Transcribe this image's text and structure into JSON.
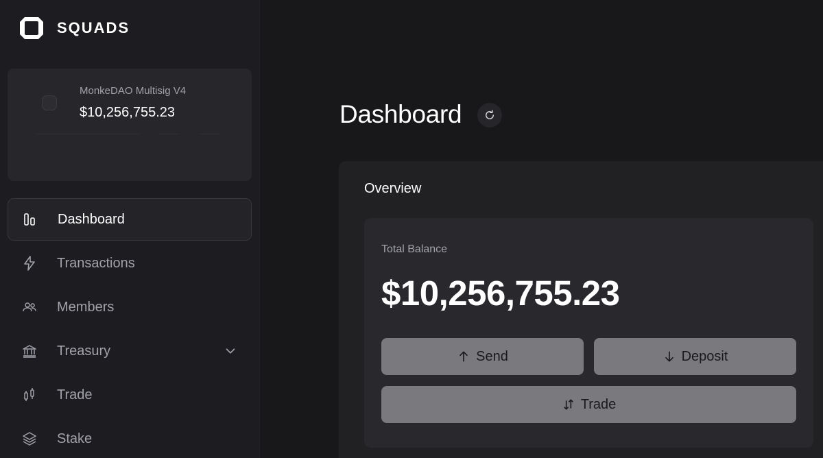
{
  "brand": {
    "name": "SQUADS"
  },
  "wallet": {
    "name": "MonkeDAO Multisig V4",
    "balance": "$10,256,755.23"
  },
  "nav": {
    "items": [
      {
        "label": "Dashboard",
        "icon": "bar-columns-icon",
        "active": true
      },
      {
        "label": "Transactions",
        "icon": "lightning-icon",
        "active": false
      },
      {
        "label": "Members",
        "icon": "users-icon",
        "active": false
      },
      {
        "label": "Treasury",
        "icon": "bank-icon",
        "active": false,
        "expandable": true
      },
      {
        "label": "Trade",
        "icon": "candlestick-icon",
        "active": false
      },
      {
        "label": "Stake",
        "icon": "layers-icon",
        "active": false
      }
    ]
  },
  "main": {
    "title": "Dashboard",
    "overview": {
      "title": "Overview",
      "total_balance_label": "Total Balance",
      "total_balance": "$10,256,755.23",
      "actions": {
        "send": "Send",
        "deposit": "Deposit",
        "trade": "Trade"
      }
    }
  },
  "colors": {
    "background": "#18181b",
    "sidebar": "#1d1d21",
    "card": "#29292d",
    "button": "#7a7a7e",
    "text_primary": "#ffffff",
    "text_muted": "#a1a1aa"
  }
}
